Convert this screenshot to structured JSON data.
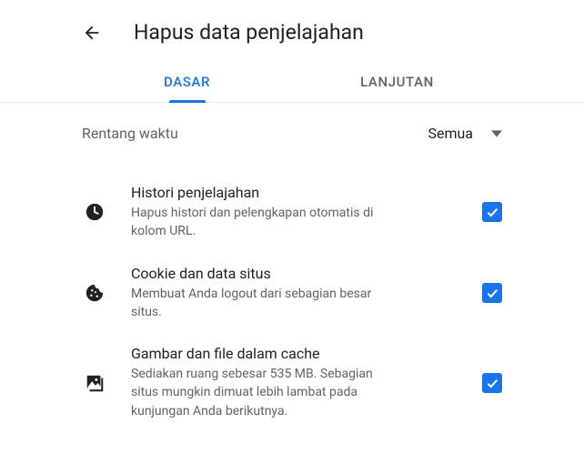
{
  "header": {
    "title": "Hapus data penjelajahan"
  },
  "tabs": {
    "basic": "DASAR",
    "advanced": "LANJUTAN",
    "active": "basic"
  },
  "time": {
    "label": "Rentang waktu",
    "value": "Semua"
  },
  "items": [
    {
      "title": "Histori penjelajahan",
      "desc": "Hapus histori dan pelengkapan otomatis di kolom URL.",
      "checked": true
    },
    {
      "title": "Cookie dan data situs",
      "desc": "Membuat Anda logout dari sebagian besar situs.",
      "checked": true
    },
    {
      "title": "Gambar dan file dalam cache",
      "desc": "Sediakan ruang sebesar 535 MB. Sebagian situs mungkin dimuat lebih lambat pada kunjungan Anda berikutnya.",
      "checked": true
    }
  ]
}
